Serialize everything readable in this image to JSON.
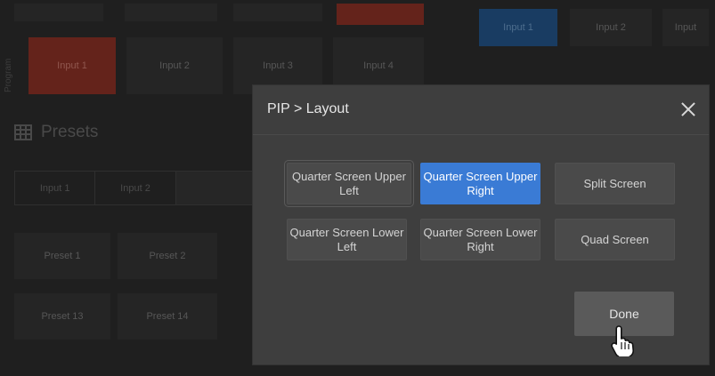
{
  "background": {
    "top_tiles_right": [
      "Input 1",
      "Input 2",
      "Input"
    ],
    "program_label": "Program",
    "program_tiles": [
      "Input 1",
      "Input 2",
      "Input 3",
      "Input 4"
    ],
    "presets_title": "Presets",
    "preset_inputs": [
      "Input 1",
      "Input 2"
    ],
    "preset_tiles": [
      "Preset 1",
      "Preset 2",
      "Preset 13",
      "Preset 14"
    ]
  },
  "modal": {
    "title": "PIP > Layout",
    "layouts": [
      {
        "label": "Quarter Screen Upper Left"
      },
      {
        "label": "Quarter Screen Upper Right"
      },
      {
        "label": "Split Screen"
      },
      {
        "label": "Quarter Screen Lower Left"
      },
      {
        "label": "Quarter Screen Lower Right"
      },
      {
        "label": "Quad Screen"
      }
    ],
    "selected_layout": "Quarter Screen Upper Right",
    "done_label": "Done"
  },
  "colors": {
    "selected": "#3a7bd5",
    "program_active": "#7a2b22",
    "preview_active": "#1f4a78"
  },
  "icons": {
    "close": "close-icon",
    "presets": "grid-icon",
    "cursor": "hand-pointer-icon"
  }
}
